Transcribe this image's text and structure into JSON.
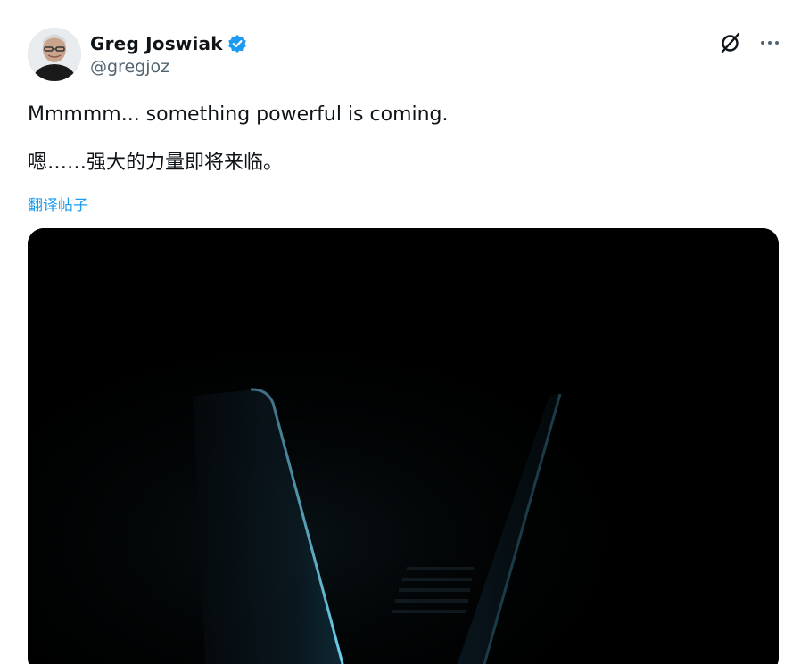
{
  "author": {
    "display_name": "Greg Joswiak",
    "handle": "@gregjoz",
    "verified": true,
    "verified_icon": "verified-badge-icon",
    "verified_color": "#1d9bf0"
  },
  "header_actions": {
    "grok_icon": "grok-icon",
    "more_icon": "more-horizontal-icon"
  },
  "post": {
    "text_en": "Mmmmm... something powerful is coming.",
    "text_zh": "嗯……强大的力量即将来临。",
    "translate_label": "翻译帖子"
  },
  "media": {
    "description_icon": "teaser-image"
  },
  "colors": {
    "text": "#0f1419",
    "secondary": "#536471",
    "link": "#1d9bf0",
    "media_bg": "#000000"
  }
}
